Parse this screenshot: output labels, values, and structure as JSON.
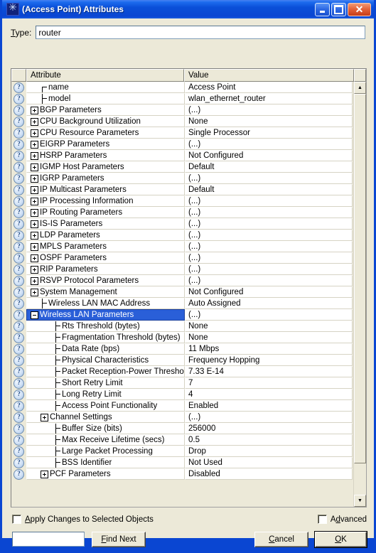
{
  "window": {
    "title": "(Access Point) Attributes",
    "app_icon": "star-burst-icon",
    "minimize_label": "Minimize",
    "maximize_label": "Maximize",
    "close_label": "Close",
    "frame_color": "#0a46d2",
    "titlebar_color": "#0a4fd8",
    "face_color": "#ece9d8"
  },
  "type_field": {
    "label": "Type:",
    "value": "router",
    "placeholder": ""
  },
  "grid": {
    "columns": [
      "Attribute",
      "Value"
    ],
    "selection_color": "#2a5fd8",
    "rows": [
      {
        "indent": 1,
        "marker": "branch-first",
        "attribute": "name",
        "value": "Access Point",
        "selected": false
      },
      {
        "indent": 1,
        "marker": "branch",
        "attribute": "model",
        "value": "wlan_ethernet_router",
        "selected": false
      },
      {
        "indent": 0,
        "marker": "plus",
        "attribute": "BGP Parameters",
        "value": "(...)",
        "selected": false
      },
      {
        "indent": 0,
        "marker": "plus",
        "attribute": "CPU Background Utilization",
        "value": "None",
        "selected": false
      },
      {
        "indent": 0,
        "marker": "plus",
        "attribute": "CPU Resource Parameters",
        "value": "Single Processor",
        "selected": false
      },
      {
        "indent": 0,
        "marker": "plus",
        "attribute": "EIGRP Parameters",
        "value": "(...)",
        "selected": false
      },
      {
        "indent": 0,
        "marker": "plus",
        "attribute": "HSRP Parameters",
        "value": "Not Configured",
        "selected": false
      },
      {
        "indent": 0,
        "marker": "plus",
        "attribute": "IGMP Host Parameters",
        "value": "Default",
        "selected": false
      },
      {
        "indent": 0,
        "marker": "plus",
        "attribute": "IGRP Parameters",
        "value": "(...)",
        "selected": false
      },
      {
        "indent": 0,
        "marker": "plus",
        "attribute": "IP Multicast Parameters",
        "value": "Default",
        "selected": false
      },
      {
        "indent": 0,
        "marker": "plus",
        "attribute": "IP Processing Information",
        "value": "(...)",
        "selected": false
      },
      {
        "indent": 0,
        "marker": "plus",
        "attribute": "IP Routing Parameters",
        "value": "(...)",
        "selected": false
      },
      {
        "indent": 0,
        "marker": "plus",
        "attribute": "IS-IS Parameters",
        "value": "(...)",
        "selected": false
      },
      {
        "indent": 0,
        "marker": "plus",
        "attribute": "LDP Parameters",
        "value": "(...)",
        "selected": false
      },
      {
        "indent": 0,
        "marker": "plus",
        "attribute": "MPLS Parameters",
        "value": "(...)",
        "selected": false
      },
      {
        "indent": 0,
        "marker": "plus",
        "attribute": "OSPF Parameters",
        "value": "(...)",
        "selected": false
      },
      {
        "indent": 0,
        "marker": "plus",
        "attribute": "RIP Parameters",
        "value": "(...)",
        "selected": false
      },
      {
        "indent": 0,
        "marker": "plus",
        "attribute": "RSVP Protocol Parameters",
        "value": "(...)",
        "selected": false
      },
      {
        "indent": 0,
        "marker": "plus",
        "attribute": "System Management",
        "value": "Not Configured",
        "selected": false
      },
      {
        "indent": 1,
        "marker": "branch",
        "attribute": "Wireless LAN MAC Address",
        "value": "Auto Assigned",
        "selected": false
      },
      {
        "indent": 0,
        "marker": "minus",
        "attribute": "Wireless LAN Parameters",
        "value": "(...)",
        "selected": true
      },
      {
        "indent": 2,
        "marker": "branch",
        "attribute": "Rts Threshold (bytes)",
        "value": "None",
        "selected": false
      },
      {
        "indent": 2,
        "marker": "branch",
        "attribute": "Fragmentation Threshold (bytes)",
        "value": "None",
        "selected": false
      },
      {
        "indent": 2,
        "marker": "branch",
        "attribute": "Data Rate (bps)",
        "value": "11 Mbps",
        "selected": false
      },
      {
        "indent": 2,
        "marker": "branch",
        "attribute": "Physical Characteristics",
        "value": "Frequency Hopping",
        "selected": false
      },
      {
        "indent": 2,
        "marker": "branch",
        "attribute": "Packet Reception-Power Threshold (...",
        "value": "7.33 E-14",
        "selected": false
      },
      {
        "indent": 2,
        "marker": "branch",
        "attribute": "Short Retry Limit",
        "value": "7",
        "selected": false
      },
      {
        "indent": 2,
        "marker": "branch",
        "attribute": "Long Retry Limit",
        "value": "4",
        "selected": false
      },
      {
        "indent": 2,
        "marker": "branch",
        "attribute": "Access Point Functionality",
        "value": "Enabled",
        "selected": false
      },
      {
        "indent": 1,
        "marker": "plus",
        "attribute": "Channel Settings",
        "value": "(...)",
        "selected": false
      },
      {
        "indent": 2,
        "marker": "branch",
        "attribute": "Buffer Size (bits)",
        "value": "256000",
        "selected": false
      },
      {
        "indent": 2,
        "marker": "branch",
        "attribute": "Max Receive Lifetime (secs)",
        "value": "0.5",
        "selected": false
      },
      {
        "indent": 2,
        "marker": "branch",
        "attribute": "Large Packet Processing",
        "value": "Drop",
        "selected": false
      },
      {
        "indent": 2,
        "marker": "branch",
        "attribute": "BSS Identifier",
        "value": "Not Used",
        "selected": false
      },
      {
        "indent": 1,
        "marker": "plus",
        "attribute": "PCF Parameters",
        "value": "Disabled",
        "selected": false
      }
    ],
    "scrollbar": {
      "up_glyph": "▲",
      "down_glyph": "▼",
      "up_name": "scroll-up-icon",
      "down_name": "scroll-down-icon"
    }
  },
  "footer": {
    "apply_checkbox_label": "Apply Changes to Selected Objects",
    "apply_checkbox_accel": "A",
    "apply_checked": false,
    "advanced_checkbox_label": "Advanced",
    "advanced_checkbox_accel": "d",
    "advanced_checked": false,
    "find_value": "",
    "find_placeholder": "",
    "find_next_label": "Find Next",
    "cancel_label": "Cancel",
    "ok_label": "OK"
  }
}
